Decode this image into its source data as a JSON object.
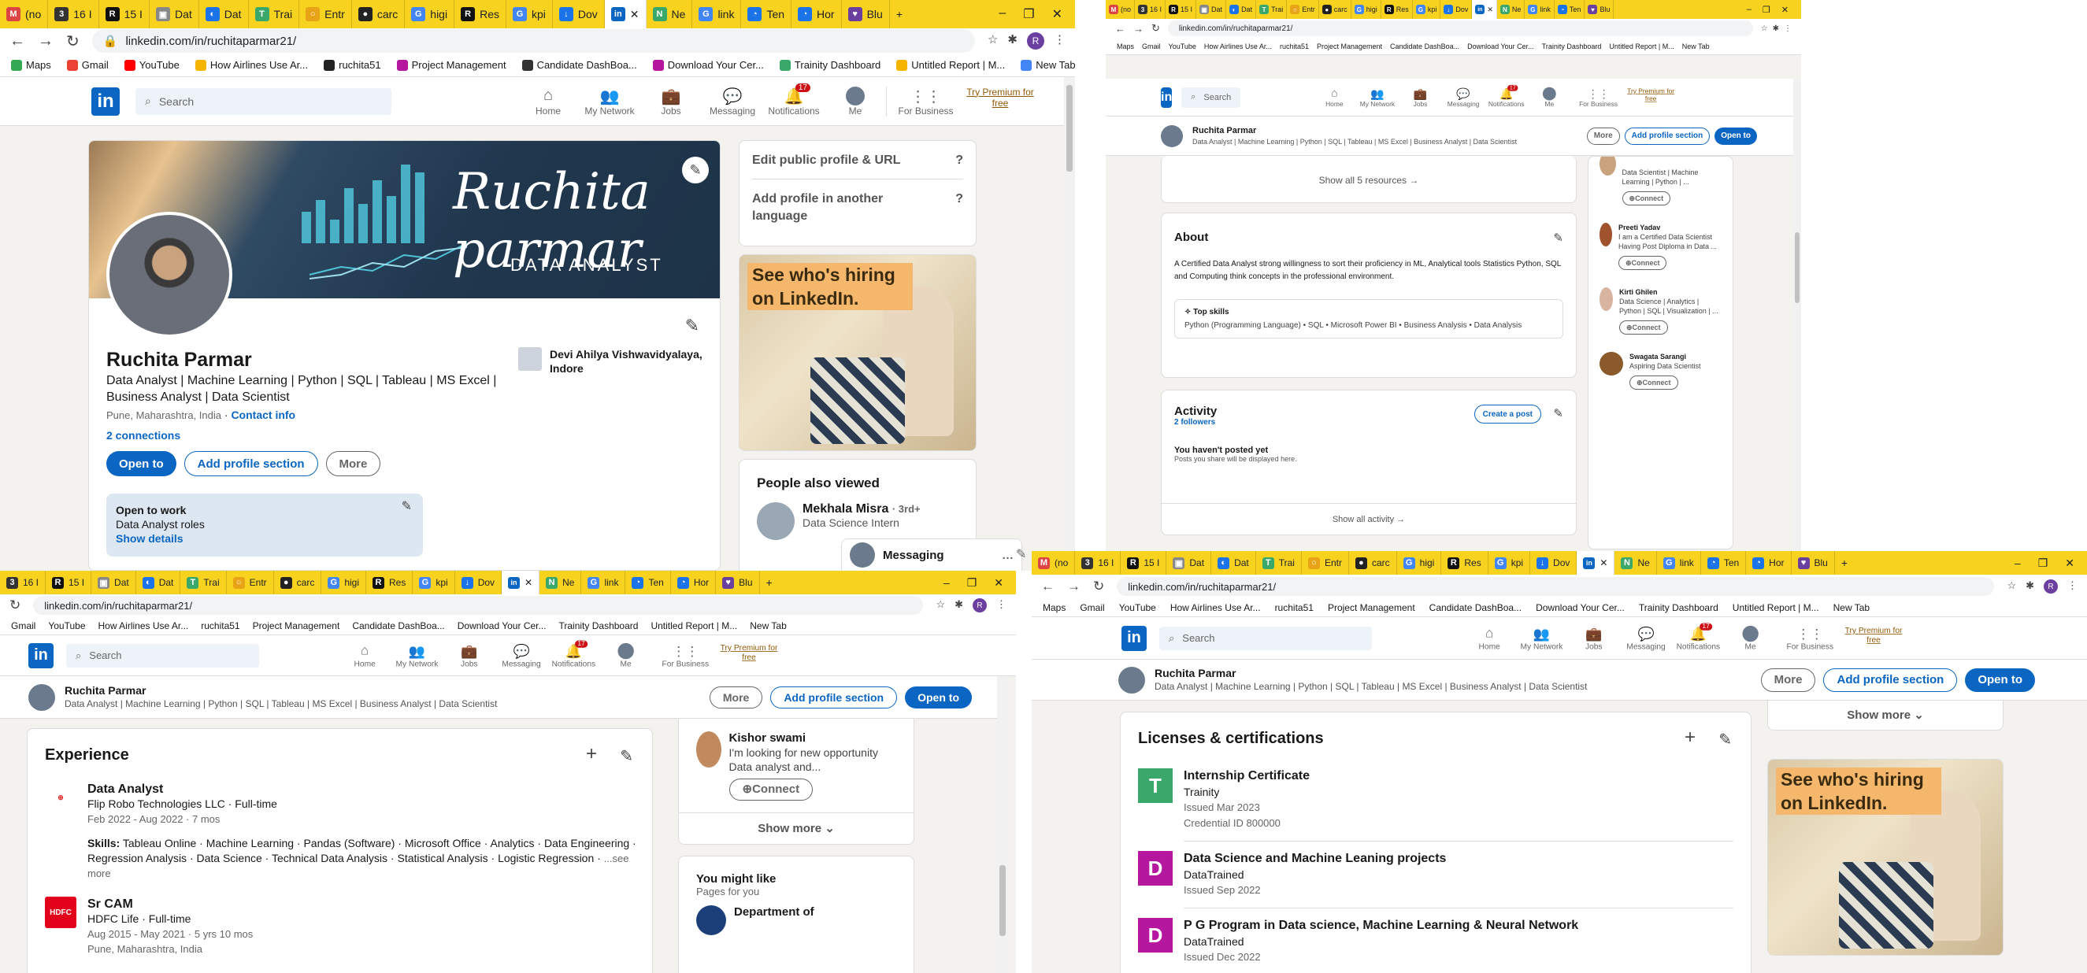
{
  "browser": {
    "tabs": [
      "(no",
      "16 I",
      "15 I",
      "Dat",
      "Dat",
      "Trai",
      "Entr",
      "carc",
      "higi",
      "Res",
      "kpi",
      "Dov",
      "",
      "Ne",
      "link",
      "Ten",
      "Hor",
      "Blu"
    ],
    "url": "linkedin.com/in/ruchitaparmar21/",
    "bookmarks": [
      "Maps",
      "Gmail",
      "YouTube",
      "How Airlines Use Ar...",
      "ruchita51",
      "Project Management",
      "Candidate DashBoa...",
      "Download Your Cer...",
      "Trainity Dashboard",
      "Untitled Report | M...",
      "New Tab"
    ],
    "profile_letter": "R",
    "win_minimize": "–",
    "win_restore": "❐",
    "win_close": "✕",
    "new_tab": "+"
  },
  "nav": {
    "search_placeholder": "Search",
    "home": "Home",
    "network": "My Network",
    "jobs": "Jobs",
    "messaging": "Messaging",
    "notifications": "Notifications",
    "notif_count": "17",
    "me": "Me",
    "business": "For Business",
    "premium": "Try Premium for free"
  },
  "profile": {
    "name": "Ruchita Parmar",
    "headline": "Data Analyst | Machine Learning | Python | SQL | Tableau | MS Excel | Business Analyst | Data Scientist",
    "location": "Pune, Maharashtra, India",
    "contact": "Contact info",
    "connections": "2 connections",
    "university": "Devi Ahilya Vishwavidyalaya, Indore",
    "banner_script": "Ruchita parmar",
    "banner_sub": "DATA ANALYST",
    "open_to": "Open to",
    "add_section": "Add profile section",
    "more": "More",
    "otw_title": "Open to work",
    "otw_roles": "Data Analyst roles",
    "otw_details": "Show details"
  },
  "sidebar": {
    "edit_url": "Edit public profile & URL",
    "add_lang": "Add profile in another language",
    "ad_text": "See who's hiring on LinkedIn.",
    "pav_title": "People also viewed",
    "pav_name": "Mekhala Misra",
    "pav_degree": "· 3rd+",
    "pav_role": "Data Science Intern",
    "messaging": "Messaging"
  },
  "w2": {
    "show_resources": "Show all 5 resources →",
    "about_title": "About",
    "about_text": "A Certified Data Analyst strong willingness to sort their proficiency in ML, Analytical tools Statistics Python, SQL and Computing think concepts in the professional environment.",
    "top_skills": "Top skills",
    "skills_list": "Python (Programming Language) • SQL • Microsoft Power BI • Business Analysis • Data Analysis",
    "activity_title": "Activity",
    "followers": "2 followers",
    "create_post": "Create a post",
    "no_posts": "You haven't posted yet",
    "no_posts_sub": "Posts you share will be displayed here.",
    "show_activity": "Show all activity →",
    "people": [
      {
        "name": "",
        "desc": "Data Scientist | Machine Learning | Python | ..."
      },
      {
        "name": "Preeti Yadav",
        "desc": "I am a Certified Data Scientist Having Post Diploma in Data ..."
      },
      {
        "name": "Kirti Ghilen",
        "desc": "Data Science | Analytics | Python | SQL | Visualization | ..."
      },
      {
        "name": "Swagata Sarangi",
        "desc": "Aspiring Data Scientist"
      }
    ],
    "connect": "Connect"
  },
  "w3": {
    "exp_title": "Experience",
    "jobs": [
      {
        "title": "Data Analyst",
        "company": "Flip Robo Technologies LLC · Full-time",
        "dates": "Feb 2022 - Aug 2022 · 7 mos",
        "skills_label": "Skills:",
        "skills": "Tableau Online · Machine Learning · Pandas (Software) · Microsoft Office · Analytics · Data Engineering · Regression Analysis · Data Science · Technical Data Analysis · Statistical Analysis · Logistic Regression ·",
        "see_more": "...see more"
      },
      {
        "title": "Sr CAM",
        "company": "HDFC Life · Full-time",
        "dates": "Aug 2015 - May 2021 · 5 yrs 10 mos",
        "location": "Pune, Maharashtra, India"
      }
    ],
    "side_name": "Kishor swami",
    "side_desc": "I'm looking for new opportunity Data analyst and...",
    "connect": "Connect",
    "show_more": "Show more",
    "ymk_title": "You might like",
    "ymk_sub": "Pages for you",
    "ymk_page": "Department of"
  },
  "w4": {
    "lic_title": "Licenses & certifications",
    "certs": [
      {
        "letter": "T",
        "name": "Internship Certificate",
        "org": "Trainity",
        "issued": "Issued Mar 2023",
        "cred": "Credential ID 800000",
        "color": "#3aa86b"
      },
      {
        "letter": "D",
        "name": "Data Science and Machine Leaning projects",
        "org": "DataTrained",
        "issued": "Issued Sep 2022",
        "cred": "",
        "color": "#b5179e"
      },
      {
        "letter": "D",
        "name": "P G Program in Data science, Machine Learning & Neural Network",
        "org": "DataTrained",
        "issued": "Issued Dec 2022",
        "cred": "",
        "color": "#b5179e"
      }
    ],
    "show_more": "Show more",
    "ad_text": "See who's hiring on LinkedIn."
  }
}
